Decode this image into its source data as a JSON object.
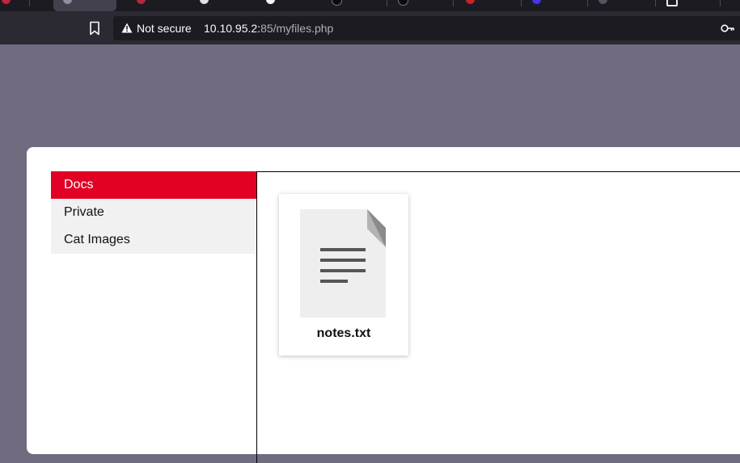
{
  "browser": {
    "security_label": "Not secure",
    "url_host": "10.10.95.2:",
    "url_path": "85/myfiles.php",
    "accent": "#e20025"
  },
  "sidebar": {
    "items": [
      {
        "label": "Docs",
        "active": true
      },
      {
        "label": "Private",
        "active": false
      },
      {
        "label": "Cat Images",
        "active": false
      }
    ]
  },
  "files": [
    {
      "name": "notes.txt",
      "icon": "text-file-icon"
    }
  ]
}
